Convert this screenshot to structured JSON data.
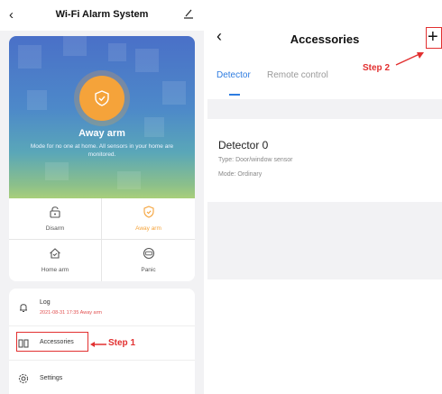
{
  "left": {
    "header": {
      "title": "Wi-Fi Alarm System"
    },
    "hero": {
      "mode": "Away arm",
      "description": "Mode for no one at home. All sensors in your home are monitored."
    },
    "modes": [
      {
        "label": "Disarm",
        "icon": "unlock-icon",
        "active": false
      },
      {
        "label": "Away arm",
        "icon": "shield-icon",
        "active": true
      },
      {
        "label": "Home arm",
        "icon": "home-icon",
        "active": false
      },
      {
        "label": "Panic",
        "icon": "sos-icon",
        "active": false
      }
    ],
    "menu": {
      "log": {
        "label": "Log",
        "sub": "2021-08-31 17:35 Away arm"
      },
      "accessories": {
        "label": "Accessories"
      },
      "settings": {
        "label": "Settings"
      }
    },
    "annotation": {
      "step": "Step 1"
    }
  },
  "right": {
    "header": {
      "title": "Accessories"
    },
    "tabs": [
      {
        "label": "Detector",
        "active": true
      },
      {
        "label": "Remote control",
        "active": false
      }
    ],
    "detector": {
      "name": "Detector 0",
      "type": "Type: Door/window sensor",
      "mode": "Mode: Ordinary"
    },
    "annotation": {
      "step": "Step 2"
    }
  },
  "colors": {
    "accent": "#f5a33a",
    "tab_active": "#2e7ce0",
    "annotation": "#e23030"
  }
}
